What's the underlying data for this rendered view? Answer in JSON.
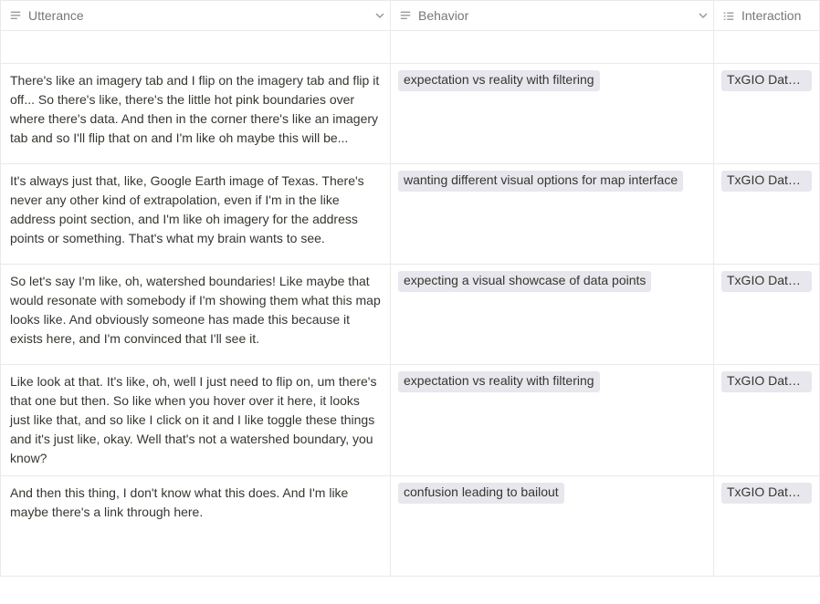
{
  "columns": {
    "utterance": {
      "label": "Utterance"
    },
    "behavior": {
      "label": "Behavior"
    },
    "interaction": {
      "label": "Interaction"
    }
  },
  "tag_colors": {
    "behavior_bg": "#e8e7ee",
    "interaction_bg": "#e8e7ee"
  },
  "rows": [
    {
      "utterance": "There's like an imagery tab and I flip on the imagery tab and flip it off... So there's like, there's the little hot pink boundaries over where there's data. And then in the corner there's like an imagery tab and so I'll flip that on and I'm like oh maybe this will be...",
      "behavior": "expectation vs reality with filtering",
      "interaction": "TxGIO Datahub"
    },
    {
      "utterance": "It's always just that, like, Google Earth image of Texas. There's never any other kind of extrapolation, even if I'm in the like address point section, and I'm like oh imagery for the address points or something. That's what my brain wants to see.",
      "behavior": "wanting different visual options for map interface",
      "interaction": "TxGIO Datahub"
    },
    {
      "utterance": "So let's say I'm like, oh, watershed boundaries! Like maybe that would resonate with somebody if I'm showing them what this map looks like. And obviously someone has made this because it exists here, and I'm convinced that I'll see it.",
      "behavior": "expecting a visual showcase of data points",
      "interaction": "TxGIO Datahub"
    },
    {
      "utterance": "Like look at that. It's like, oh, well I just need to flip on, um there's that one but then. So like when you hover over it here, it looks just like that, and so like I click on it and I like toggle these things and it's just like, okay. Well that's not a watershed boundary, you know?",
      "behavior": "expectation vs reality with filtering",
      "interaction": "TxGIO Datahub"
    },
    {
      "utterance": "And then this thing, I don't know what this does. And I'm like maybe there's a link through here.",
      "behavior": "confusion leading to bailout",
      "interaction": "TxGIO Datahub"
    }
  ]
}
